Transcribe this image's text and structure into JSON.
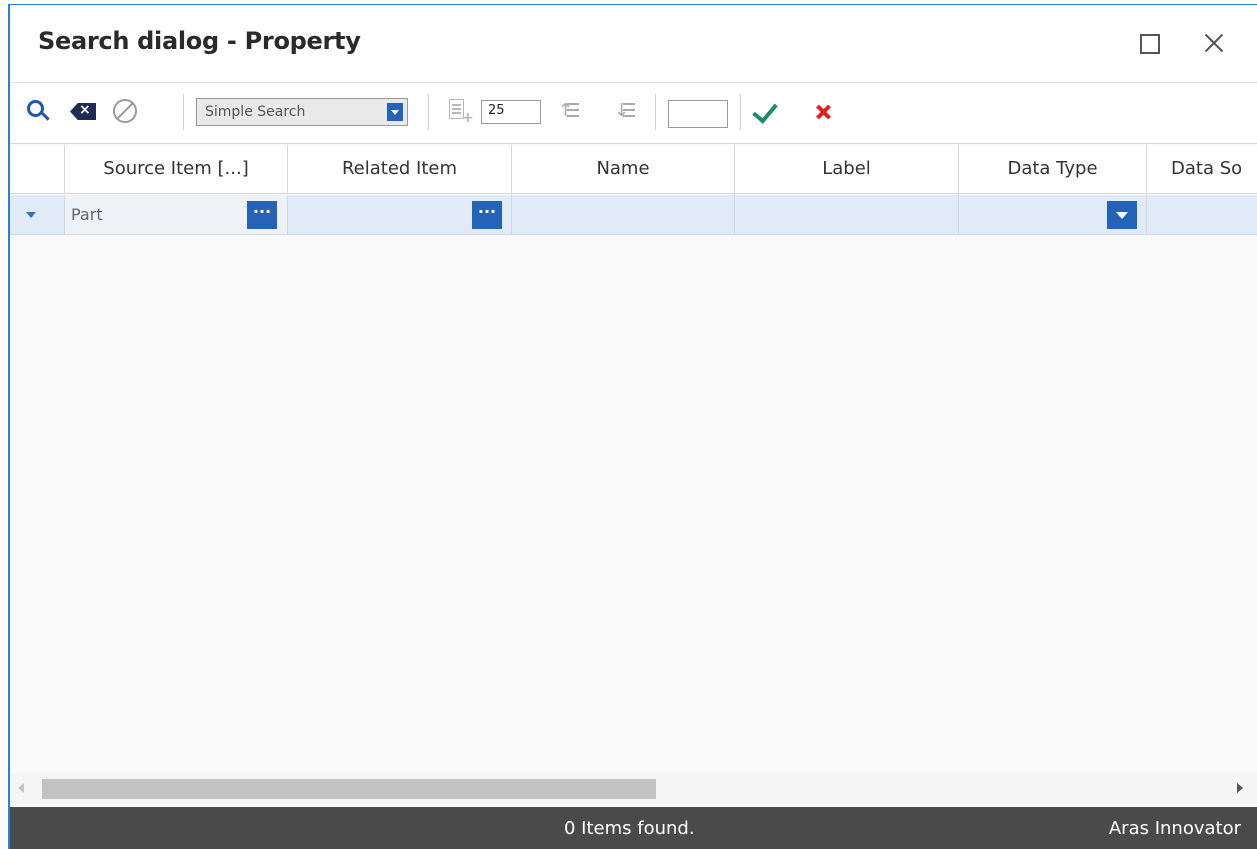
{
  "dialog": {
    "title": "Search dialog - Property"
  },
  "window_controls": {
    "maximize_icon": "maximize-icon",
    "close_icon": "close-icon"
  },
  "toolbar": {
    "search_icon": "search-icon",
    "clear_icon": "clear-criteria-icon",
    "stop_icon": "stop-search-icon",
    "search_mode": "Simple Search",
    "page_size": "25",
    "page_number": "",
    "ok_icon": "checkmark-icon",
    "cancel_icon": "cancel-x-icon"
  },
  "grid": {
    "columns": [
      "Source Item [...]",
      "Related Item",
      "Name",
      "Label",
      "Data Type",
      "Data So"
    ],
    "search_row": {
      "source_item": "Part",
      "related_item": "",
      "name": "",
      "label": "",
      "data_type": "",
      "data_source": ""
    }
  },
  "status": {
    "message": "0 Items found.",
    "brand": "Aras Innovator"
  },
  "colors": {
    "accent_blue": "#2463b8",
    "search_row_bg": "#e1eaf7",
    "status_bar_bg": "#4a4a4a",
    "ok_green": "#1d8a6a",
    "cancel_red": "#e02020"
  }
}
